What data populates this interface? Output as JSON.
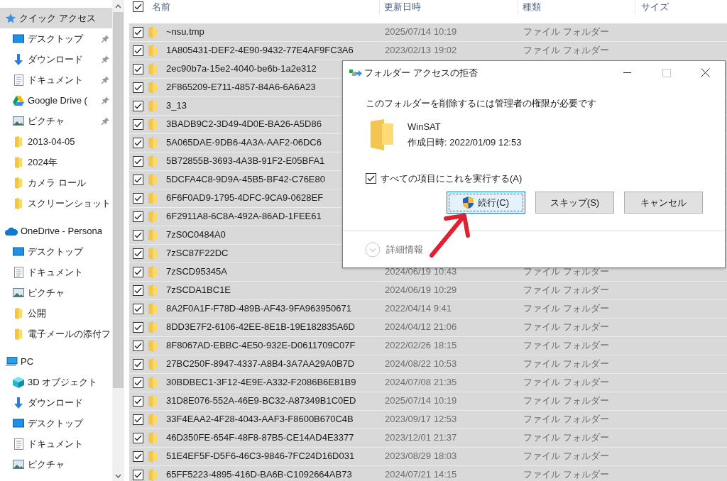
{
  "sidebar": {
    "sections": [
      {
        "label": "クイック アクセス",
        "kind": "star",
        "selected": true,
        "items": [
          {
            "label": "デスクトップ",
            "kind": "desktop",
            "pinned": true
          },
          {
            "label": "ダウンロード",
            "kind": "download",
            "pinned": true
          },
          {
            "label": "ドキュメント",
            "kind": "document",
            "pinned": true
          },
          {
            "label": "Google Drive (",
            "kind": "drive",
            "pinned": true
          },
          {
            "label": "ピクチャ",
            "kind": "picture",
            "pinned": true
          },
          {
            "label": "2013-04-05",
            "kind": "folder",
            "pinned": false
          },
          {
            "label": "2024年",
            "kind": "folder",
            "pinned": false
          },
          {
            "label": "カメラ ロール",
            "kind": "folder",
            "pinned": false
          },
          {
            "label": "スクリーンショット",
            "kind": "folder",
            "pinned": false
          }
        ]
      },
      {
        "label": "OneDrive - Persona",
        "kind": "cloud",
        "selected": false,
        "items": [
          {
            "label": "デスクトップ",
            "kind": "desktop",
            "pinned": false
          },
          {
            "label": "ドキュメント",
            "kind": "document",
            "pinned": false
          },
          {
            "label": "ピクチャ",
            "kind": "picture",
            "pinned": false
          },
          {
            "label": "公開",
            "kind": "folder",
            "pinned": false
          },
          {
            "label": "電子メールの添付フ",
            "kind": "folder",
            "pinned": false
          }
        ]
      },
      {
        "label": "PC",
        "kind": "pc",
        "selected": false,
        "items": [
          {
            "label": "3D オブジェクト",
            "kind": "cube",
            "pinned": false
          },
          {
            "label": "ダウンロード",
            "kind": "download",
            "pinned": false
          },
          {
            "label": "デスクトップ",
            "kind": "desktop",
            "pinned": false
          },
          {
            "label": "ドキュメント",
            "kind": "document",
            "pinned": false
          },
          {
            "label": "ピクチャ",
            "kind": "picture",
            "pinned": false
          }
        ]
      }
    ]
  },
  "table": {
    "select_all_checked": true,
    "columns": [
      "名前",
      "更新日時",
      "種類",
      "サイズ"
    ],
    "rows": [
      {
        "name": "~nsu.tmp",
        "date": "2025/07/14 10:19",
        "type": "ファイル フォルダー",
        "checked": true,
        "selected": true
      },
      {
        "name": "1A805431-DEF2-4E90-9432-77E4AF9FC3A6",
        "date": "2023/02/13 19:02",
        "type": "ファイル フォルダー",
        "checked": true,
        "selected": true
      },
      {
        "name": "2ec90b7a-15e2-4040-be6b-1a2e312",
        "checked": true,
        "selected": true
      },
      {
        "name": "2F865209-E711-4857-84A6-6A6A23",
        "checked": true,
        "selected": true
      },
      {
        "name": "3_13",
        "checked": true,
        "selected": true
      },
      {
        "name": "3BADB9C2-3D49-4D0E-BA26-A5D86",
        "checked": true,
        "selected": true
      },
      {
        "name": "5A065DAE-9DB6-4A3A-AAF2-06DC6",
        "checked": true,
        "selected": true
      },
      {
        "name": "5B72855B-3693-4A3B-91F2-E05BFA1",
        "checked": true,
        "selected": true
      },
      {
        "name": "5DCFA4C8-9D9A-45B5-BF42-C76E80",
        "checked": true,
        "selected": true
      },
      {
        "name": "6F6F0AD9-1795-4DFC-9CA9-0628EF",
        "checked": true,
        "selected": true
      },
      {
        "name": "6F2911A8-6C8A-492A-86AD-1FEE61",
        "checked": true,
        "selected": true
      },
      {
        "name": "7zS0C0484A0",
        "checked": true,
        "selected": true
      },
      {
        "name": "7zSC87F22DC",
        "checked": true,
        "selected": true
      },
      {
        "name": "7zSCD95345A",
        "date": "2024/06/19 10:43",
        "type": "ファイル フォルダー",
        "checked": true,
        "selected": true
      },
      {
        "name": "7zSCDA1BC1E",
        "date": "2024/06/19 10:29",
        "type": "ファイル フォルダー",
        "checked": true,
        "selected": true
      },
      {
        "name": "8A2F0A1F-F78D-489B-AF43-9FA963950671",
        "date": "2022/04/14 9:41",
        "type": "ファイル フォルダー",
        "checked": true,
        "selected": true
      },
      {
        "name": "8DD3E7F2-6106-42EE-8E1B-19E182835A6D",
        "date": "2024/04/12 21:06",
        "type": "ファイル フォルダー",
        "checked": true,
        "selected": true
      },
      {
        "name": "8F8067AD-EBBC-4E50-932E-D0611709C07F",
        "date": "2022/02/26 18:15",
        "type": "ファイル フォルダー",
        "checked": true,
        "selected": true
      },
      {
        "name": "27BC250F-8947-4337-A8B4-3A7AA29A0B7D",
        "date": "2024/08/22 10:53",
        "type": "ファイル フォルダー",
        "checked": true,
        "selected": true
      },
      {
        "name": "30BDBEC1-3F12-4E9E-A332-F2086B6E81B9",
        "date": "2024/07/08 21:35",
        "type": "ファイル フォルダー",
        "checked": true,
        "selected": true
      },
      {
        "name": "31D8E076-552A-46E9-BC32-A87349B1C0ED",
        "date": "2025/07/14 10:19",
        "type": "ファイル フォルダー",
        "checked": true,
        "selected": true
      },
      {
        "name": "33F4EAA2-4F28-4043-AAF3-F8600B670C4B",
        "date": "2023/09/17 12:53",
        "type": "ファイル フォルダー",
        "checked": true,
        "selected": true
      },
      {
        "name": "46D350FE-654F-48F8-87B5-CE14AD4E3377",
        "date": "2023/12/01 21:37",
        "type": "ファイル フォルダー",
        "checked": true,
        "selected": true
      },
      {
        "name": "51E4EF5F-D5F6-46C3-9846-7FC24D16D031",
        "date": "2023/08/29 18:03",
        "type": "ファイル フォルダー",
        "checked": true,
        "selected": true
      },
      {
        "name": "65FF5223-4895-416D-BA6B-C1092664AB73",
        "date": "2024/07/21 14:15",
        "type": "ファイル フォルダー",
        "checked": true,
        "selected": true
      }
    ]
  },
  "dialog": {
    "title": "フォルダー アクセスの拒否",
    "message": "このフォルダーを削除するには管理者の権限が必要です",
    "item_name": "WinSAT",
    "item_created": "作成日時: 2022/01/09 12:53",
    "apply_all": {
      "label": "すべての項目にこれを実行する(A)",
      "checked": true
    },
    "buttons": [
      {
        "label": "続行(C)",
        "kind": "primary",
        "shield": true
      },
      {
        "label": "スキップ(S)",
        "kind": "normal",
        "shield": false
      },
      {
        "label": "キャンセル",
        "kind": "normal",
        "shield": false
      }
    ],
    "details": "詳細情報"
  }
}
